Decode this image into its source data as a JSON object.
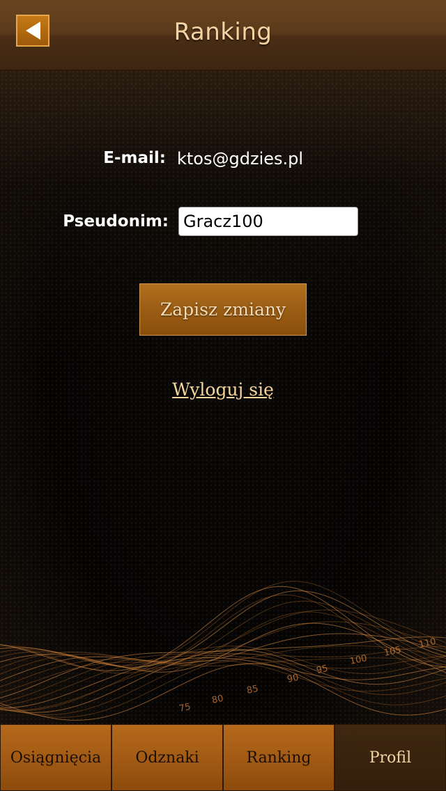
{
  "header": {
    "title": "Ranking",
    "back_icon": "back-arrow-icon"
  },
  "profile": {
    "email_label": "E-mail:",
    "email_value": "ktos@gdzies.pl",
    "nick_label": "Pseudonim:",
    "nick_value": "Gracz100"
  },
  "actions": {
    "save_label": "Zapisz zmiany",
    "logout_label": "Wyloguj się"
  },
  "tabs": [
    {
      "label": "Osiągnięcia",
      "active": false
    },
    {
      "label": "Odznaki",
      "active": false
    },
    {
      "label": "Ranking",
      "active": false
    },
    {
      "label": "Profil",
      "active": true
    }
  ],
  "decoration": {
    "wave_numbers": [
      "75",
      "80",
      "85",
      "90",
      "95",
      "100",
      "105",
      "110"
    ]
  },
  "colors": {
    "accent": "#a35b14",
    "header": "#5a391b",
    "title_text": "#f3d3a3",
    "link_text": "#f5d59b"
  }
}
